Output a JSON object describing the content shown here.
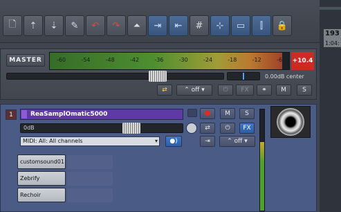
{
  "toolbar": {
    "buttons": [
      {
        "id": "new-project",
        "icon": "document-new-icon",
        "glyph": "🗋"
      },
      {
        "id": "open-project",
        "icon": "folder-open-icon",
        "glyph": "⇡"
      },
      {
        "id": "save-project",
        "icon": "save-icon",
        "glyph": "⇣"
      },
      {
        "id": "settings",
        "icon": "wrench-icon",
        "glyph": "✎"
      },
      {
        "id": "undo",
        "icon": "undo-icon",
        "glyph": "↶"
      },
      {
        "id": "redo",
        "icon": "redo-icon",
        "glyph": "↷"
      },
      {
        "id": "metronome",
        "icon": "metronome-icon",
        "glyph": "⏶"
      },
      {
        "id": "ripple-one",
        "icon": "ripple-edit-icon",
        "glyph": "⇥"
      },
      {
        "id": "ripple-all",
        "icon": "ripple-all-icon",
        "glyph": "⇤"
      },
      {
        "id": "grid",
        "icon": "grid-icon",
        "glyph": "#"
      },
      {
        "id": "snap",
        "icon": "snap-icon",
        "glyph": "⊹"
      },
      {
        "id": "envelope",
        "icon": "envelope-icon",
        "glyph": "▭"
      },
      {
        "id": "loop",
        "icon": "loop-icon",
        "glyph": "⫿"
      },
      {
        "id": "lock",
        "icon": "lock-icon",
        "glyph": "🔒"
      }
    ]
  },
  "ruler": {
    "measure": "193",
    "time": "1:04:"
  },
  "master": {
    "label": "MASTER",
    "meter_ticks": [
      "-60",
      "-54",
      "-48",
      "-42",
      "-36",
      "-30",
      "-24",
      "-18",
      "-12",
      "-6"
    ],
    "clip_value": "+10.4",
    "volume_text": "0.00dB center",
    "fx_label": "FX",
    "mute_label": "M",
    "solo_label": "S",
    "automation_label": "off",
    "level_fraction": 0.97
  },
  "track": {
    "number": "1",
    "name": "ReaSamplOmatic5000",
    "volume_text": "0dB",
    "input": "MIDI: All: All channels",
    "mute_label": "M",
    "solo_label": "S",
    "fx_label": "FX",
    "automation_label": "off",
    "fx_chain": [
      "customsound01",
      "Zebrify",
      "Rechoir"
    ],
    "level_fraction": 0.68
  },
  "colors": {
    "track_name": "#5f3aa6",
    "clip": "#cc2a22",
    "fx_button": "#3f79c8"
  }
}
